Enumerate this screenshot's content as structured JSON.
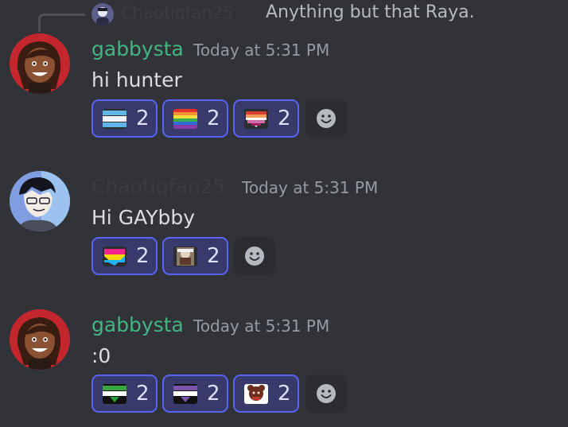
{
  "reply": {
    "author": "Chaotiqfan25",
    "text": "Anything but that Raya."
  },
  "messages": [
    {
      "author": "gabbysta",
      "timestamp": "Today at 5:31 PM",
      "content": "hi hunter",
      "author_color": "#43b581",
      "reactions": [
        {
          "emoji": "flag-emoji",
          "count": "2"
        },
        {
          "emoji": "rainbow-flag-emoji",
          "count": "2"
        },
        {
          "emoji": "lesbian-flag-heart-emoji",
          "count": "2"
        }
      ]
    },
    {
      "author": "Chaotiqfan25",
      "timestamp": "Today at 5:31 PM",
      "content": "Hi GAYbby",
      "reactions": [
        {
          "emoji": "pansexual-flag-heart-emoji",
          "count": "2"
        },
        {
          "emoji": "custom-character-emoji",
          "count": "2"
        }
      ]
    },
    {
      "author": "gabbysta",
      "timestamp": "Today at 5:31 PM",
      "content": ":0",
      "author_color": "#43b581",
      "reactions": [
        {
          "emoji": "flag-emoji",
          "count": "2"
        },
        {
          "emoji": "flag-emoji",
          "count": "2"
        },
        {
          "emoji": "custom-character-emoji",
          "count": "2"
        }
      ]
    }
  ],
  "colors": {
    "background": "#313338",
    "reaction_border": "#5865f2",
    "reaction_bg": "#373a6b",
    "timestamp": "#949ba4"
  }
}
